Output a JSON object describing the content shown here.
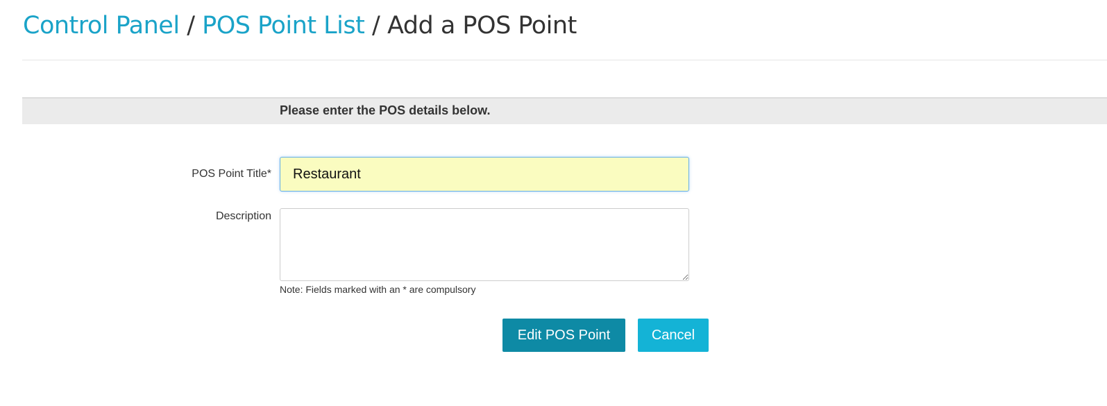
{
  "breadcrumb": {
    "items": [
      {
        "label": "Control Panel",
        "is_link": true
      },
      {
        "label": "POS Point List",
        "is_link": true
      },
      {
        "label": "Add a POS Point",
        "is_link": false
      }
    ],
    "separator": "/"
  },
  "form": {
    "instructions": "Please enter the POS details below.",
    "title_field": {
      "label": "POS Point Title*",
      "value": "Restaurant",
      "background_color": "#fafcc0"
    },
    "description_field": {
      "label": "Description",
      "value": ""
    },
    "note": "Note: Fields marked with an * are compulsory"
  },
  "actions": {
    "submit_label": "Edit POS Point",
    "cancel_label": "Cancel"
  },
  "colors": {
    "link": "#1aa3c8",
    "primary_button": "#0e8aa5",
    "cancel_button": "#14b3d6",
    "section_header_bg": "#ebebeb"
  }
}
